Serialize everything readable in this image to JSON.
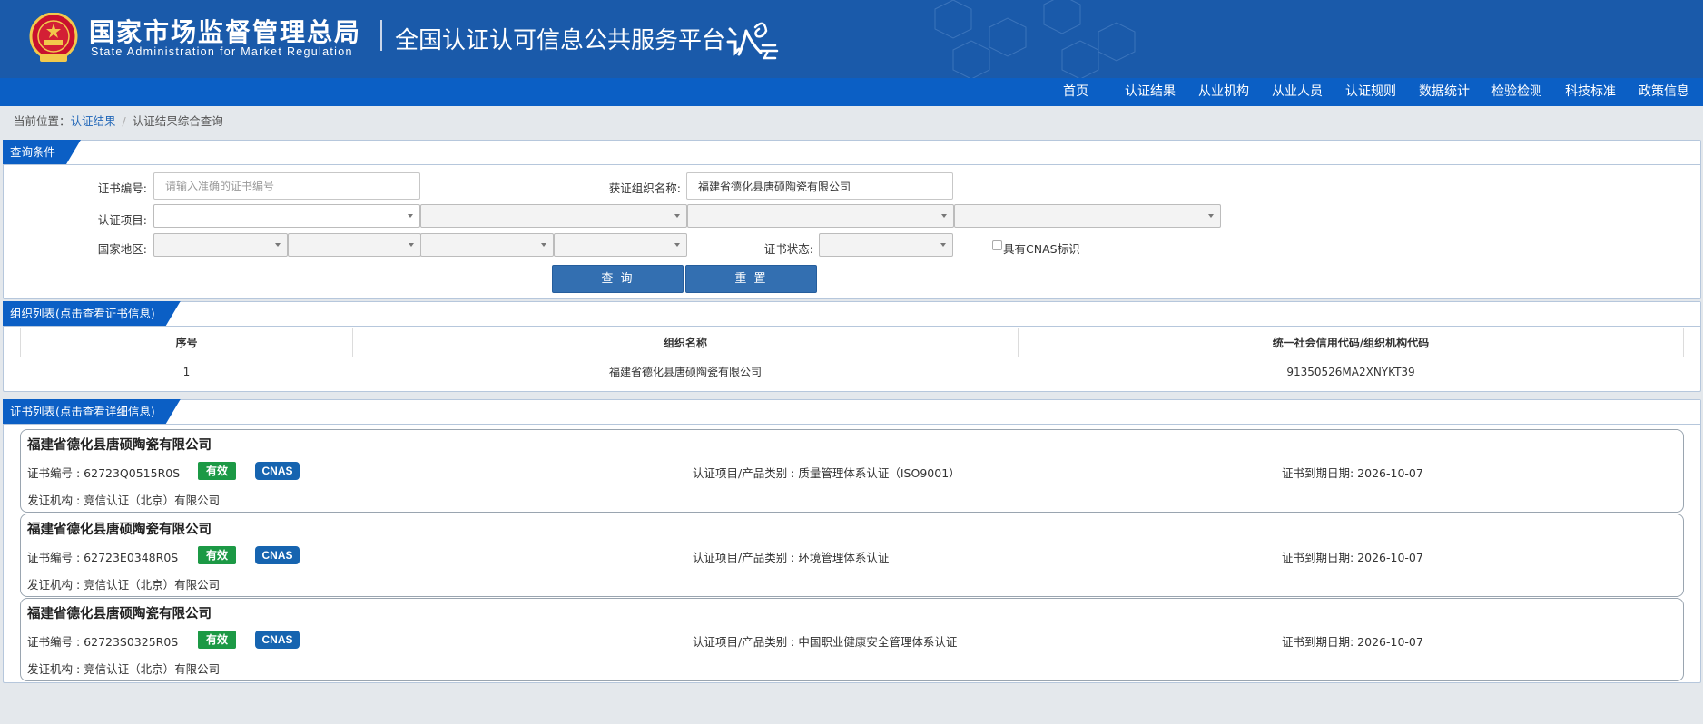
{
  "header": {
    "org_cn": "国家市场监督管理总局",
    "org_en": "State Administration  for  Market Regulation",
    "platform": "全国认证认可信息公共服务平台"
  },
  "nav": [
    "首页",
    "认证结果",
    "从业机构",
    "从业人员",
    "认证规则",
    "数据统计",
    "检验检测",
    "科技标准",
    "政策信息"
  ],
  "breadcrumb": {
    "prefix": "当前位置：",
    "link": "认证结果",
    "current": "认证结果综合查询"
  },
  "query": {
    "title": "查询条件",
    "cert_no_label": "证书编号:",
    "cert_no_placeholder": "请输入准确的证书编号",
    "org_label": "获证组织名称:",
    "org_value": "福建省德化县唐硕陶瓷有限公司",
    "project_label": "认证项目:",
    "region_label": "国家地区:",
    "status_label": "证书状态:",
    "cnas_label": "具有CNAS标识",
    "search_btn": "查 询",
    "reset_btn": "重 置"
  },
  "org_list": {
    "title": "组织列表(点击查看证书信息)",
    "columns": [
      "序号",
      "组织名称",
      "统一社会信用代码/组织机构代码"
    ],
    "rows": [
      [
        "1",
        "福建省德化县唐硕陶瓷有限公司",
        "91350526MA2XNYKT39"
      ]
    ]
  },
  "cert_list": {
    "title": "证书列表(点击查看详细信息)",
    "items": [
      {
        "name": "福建省德化县唐硕陶瓷有限公司",
        "cert_no": "证书编号 : 62723Q0515R0S",
        "status": "有效",
        "cnas": "CNAS",
        "category": "认证项目/产品类别 : 质量管理体系认证（ISO9001）",
        "expiry": "证书到期日期: 2026-10-07",
        "issuer": "发证机构 : 竞信认证（北京）有限公司"
      },
      {
        "name": "福建省德化县唐硕陶瓷有限公司",
        "cert_no": "证书编号 : 62723E0348R0S",
        "status": "有效",
        "cnas": "CNAS",
        "category": "认证项目/产品类别 : 环境管理体系认证",
        "expiry": "证书到期日期: 2026-10-07",
        "issuer": "发证机构 : 竞信认证（北京）有限公司"
      },
      {
        "name": "福建省德化县唐硕陶瓷有限公司",
        "cert_no": "证书编号 : 62723S0325R0S",
        "status": "有效",
        "cnas": "CNAS",
        "category": "认证项目/产品类别 : 中国职业健康安全管理体系认证",
        "expiry": "证书到期日期: 2026-10-07",
        "issuer": "发证机构 : 竞信认证（北京）有限公司"
      }
    ]
  },
  "colors": {
    "header_bg": "#1a5aaa",
    "nav_bg": "#0b5fc5",
    "status_green": "#1c9945",
    "cnas_blue": "#1664b0",
    "button_blue": "#336fb1"
  }
}
